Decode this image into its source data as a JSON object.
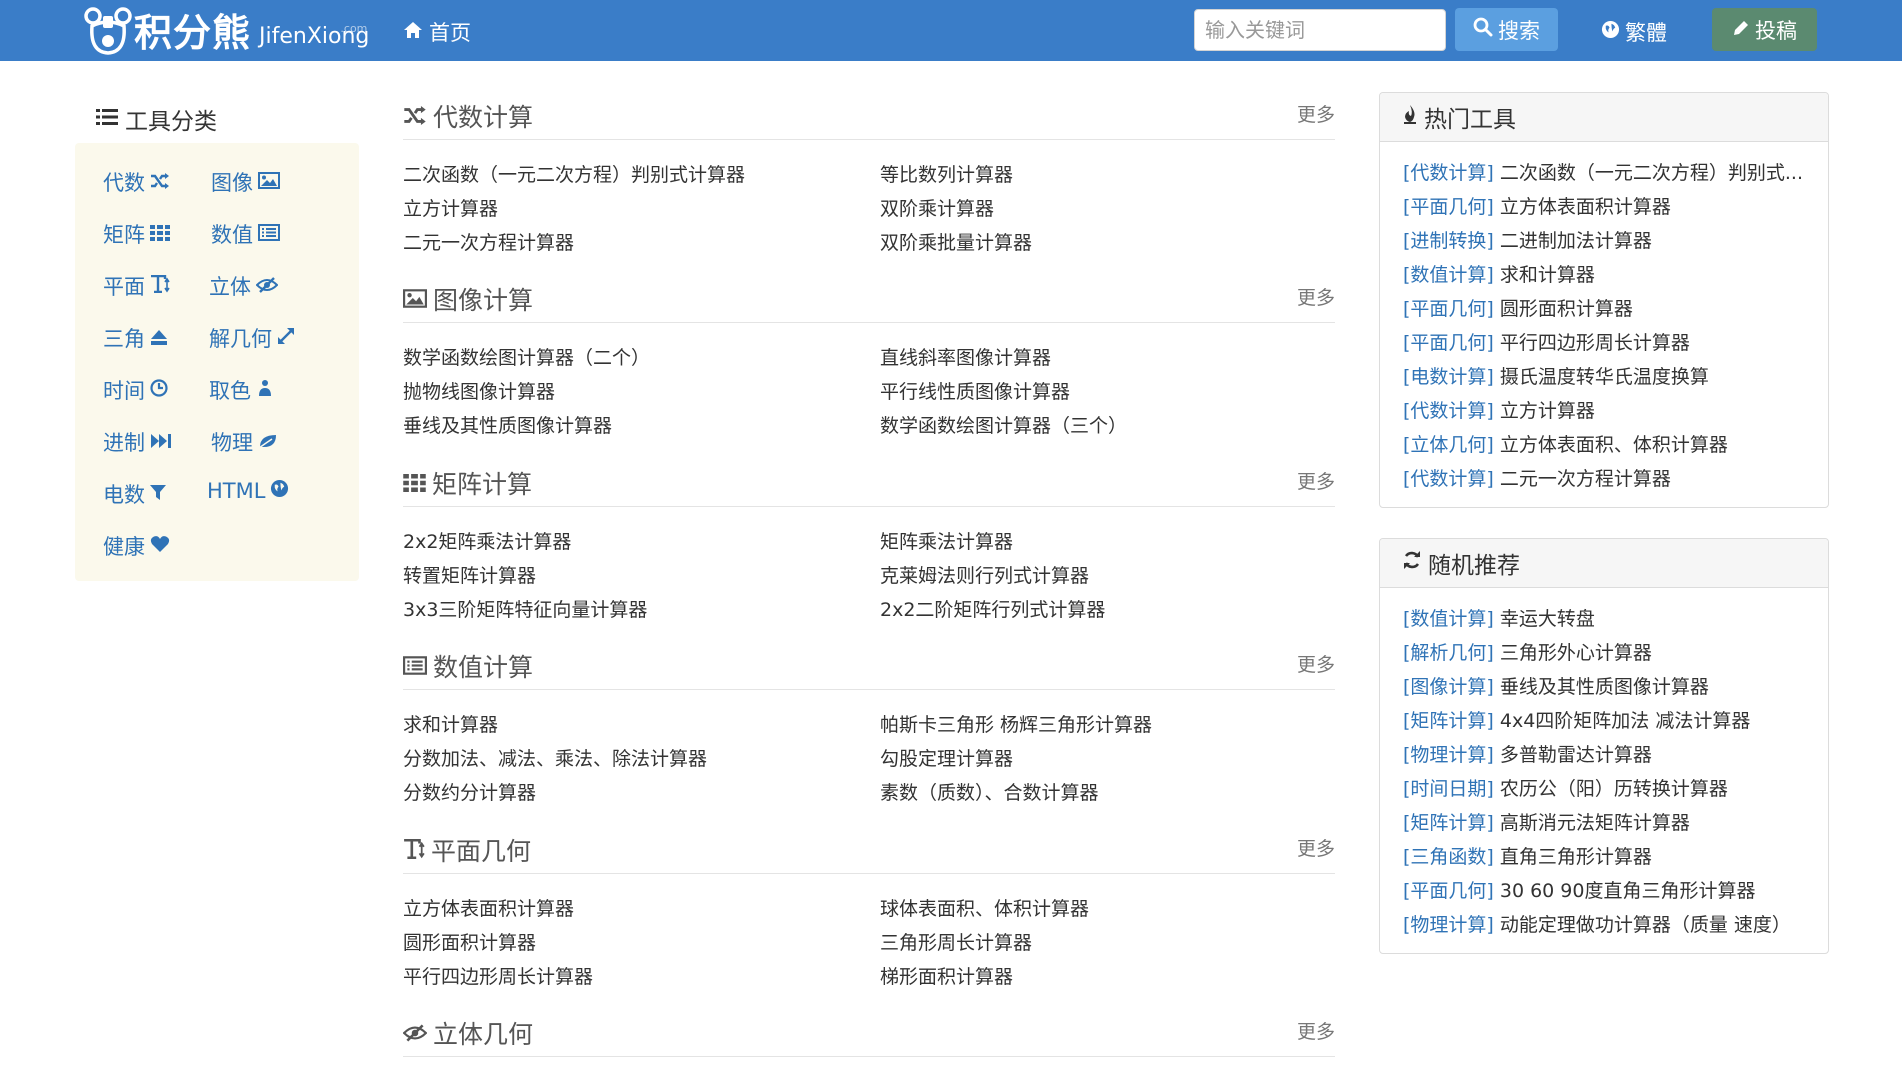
{
  "header": {
    "logo_cn": "积分熊",
    "logo_en": "JifenXiong",
    "logo_en_sup": ".com",
    "nav_home": "首页",
    "search_placeholder": "输入关键词",
    "search_button": "搜索",
    "traditional_button": "繁體",
    "submit_button": "投稿",
    "brand_color": "#3a7dc8"
  },
  "sidebar": {
    "title": "工具分类",
    "items": [
      {
        "label": "代数",
        "icon": "shuffle-icon"
      },
      {
        "label": "图像",
        "icon": "picture-icon"
      },
      {
        "label": "矩阵",
        "icon": "grid-icon"
      },
      {
        "label": "数值",
        "icon": "list-alt-icon"
      },
      {
        "label": "平面",
        "icon": "text-height-icon"
      },
      {
        "label": "立体",
        "icon": "eye-slash-icon"
      },
      {
        "label": "三角",
        "icon": "eject-icon"
      },
      {
        "label": "解几何",
        "icon": "expand-icon"
      },
      {
        "label": "时间",
        "icon": "clock-icon"
      },
      {
        "label": "取色",
        "icon": "tint-icon"
      },
      {
        "label": "进制",
        "icon": "fast-forward-icon"
      },
      {
        "label": "物理",
        "icon": "leaf-icon"
      },
      {
        "label": "电数",
        "icon": "filter-icon"
      },
      {
        "label": "HTML",
        "icon": "globe-icon"
      },
      {
        "label": "健康",
        "icon": "heart-icon"
      }
    ]
  },
  "sections": [
    {
      "title": "代数计算",
      "icon": "shuffle-icon",
      "more": "更多",
      "links": [
        "二次函数（一元二次方程）判别式计算器",
        "等比数列计算器",
        "立方计算器",
        "双阶乘计算器",
        "二元一次方程计算器",
        "双阶乘批量计算器"
      ]
    },
    {
      "title": "图像计算",
      "icon": "picture-icon",
      "more": "更多",
      "links": [
        "数学函数绘图计算器（二个）",
        "直线斜率图像计算器",
        "抛物线图像计算器",
        "平行线性质图像计算器",
        "垂线及其性质图像计算器",
        "数学函数绘图计算器（三个）"
      ]
    },
    {
      "title": "矩阵计算",
      "icon": "grid-icon",
      "more": "更多",
      "links": [
        "2x2矩阵乘法计算器",
        "矩阵乘法计算器",
        "转置矩阵计算器",
        "克莱姆法则行列式计算器",
        "3x3三阶矩阵特征向量计算器",
        "2x2二阶矩阵行列式计算器"
      ]
    },
    {
      "title": "数值计算",
      "icon": "list-alt-icon",
      "more": "更多",
      "links": [
        "求和计算器",
        "帕斯卡三角形 杨辉三角形计算器",
        "分数加法、减法、乘法、除法计算器",
        "勾股定理计算器",
        "分数约分计算器",
        "素数（质数）、合数计算器"
      ]
    },
    {
      "title": "平面几何",
      "icon": "text-height-icon",
      "more": "更多",
      "links": [
        "立方体表面积计算器",
        "球体表面积、体积计算器",
        "圆形面积计算器",
        "三角形周长计算器",
        "平行四边形周长计算器",
        "梯形面积计算器"
      ]
    },
    {
      "title": "立体几何",
      "icon": "eye-slash-icon",
      "more": "更多",
      "links": []
    }
  ],
  "hot": {
    "title": "热门工具",
    "items": [
      {
        "tag": "[代数计算]",
        "name": "二次函数（一元二次方程）判别式..."
      },
      {
        "tag": "[平面几何]",
        "name": "立方体表面积计算器"
      },
      {
        "tag": "[进制转换]",
        "name": "二进制加法计算器"
      },
      {
        "tag": "[数值计算]",
        "name": "求和计算器"
      },
      {
        "tag": "[平面几何]",
        "name": "圆形面积计算器"
      },
      {
        "tag": "[平面几何]",
        "name": "平行四边形周长计算器"
      },
      {
        "tag": "[电数计算]",
        "name": "摄氏温度转华氏温度换算"
      },
      {
        "tag": "[代数计算]",
        "name": "立方计算器"
      },
      {
        "tag": "[立体几何]",
        "name": "立方体表面积、体积计算器"
      },
      {
        "tag": "[代数计算]",
        "name": "二元一次方程计算器"
      }
    ]
  },
  "random": {
    "title": "随机推荐",
    "items": [
      {
        "tag": "[数值计算]",
        "name": "幸运大转盘"
      },
      {
        "tag": "[解析几何]",
        "name": "三角形外心计算器"
      },
      {
        "tag": "[图像计算]",
        "name": "垂线及其性质图像计算器"
      },
      {
        "tag": "[矩阵计算]",
        "name": "4x4四阶矩阵加法 减法计算器"
      },
      {
        "tag": "[物理计算]",
        "name": "多普勒雷达计算器"
      },
      {
        "tag": "[时间日期]",
        "name": "农历公（阳）历转换计算器"
      },
      {
        "tag": "[矩阵计算]",
        "name": "高斯消元法矩阵计算器"
      },
      {
        "tag": "[三角函数]",
        "name": "直角三角形计算器"
      },
      {
        "tag": "[平面几何]",
        "name": "30 60 90度直角三角形计算器"
      },
      {
        "tag": "[物理计算]",
        "name": "动能定理做功计算器（质量 速度）"
      }
    ]
  }
}
